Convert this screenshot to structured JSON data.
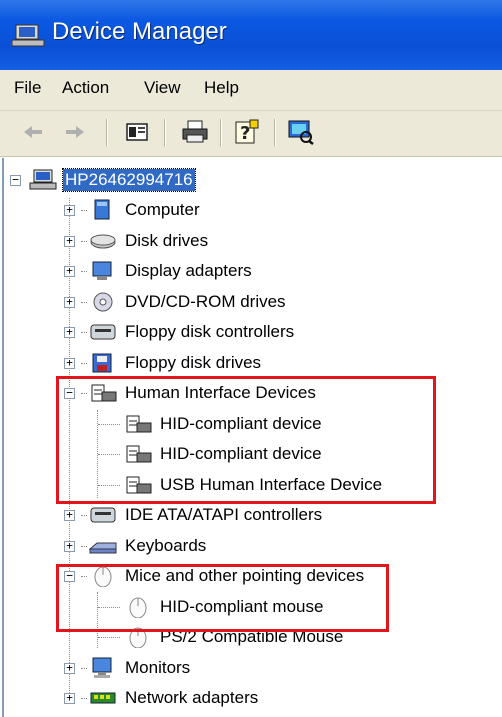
{
  "window": {
    "title": "Device Manager"
  },
  "menu": [
    "File",
    "Action",
    "View",
    "Help"
  ],
  "toolbar": [
    "back-icon",
    "forward-icon",
    "properties-view-icon",
    "print-icon",
    "help-icon",
    "scan-hardware-icon"
  ],
  "tree": {
    "root": "HP26462994716",
    "categories": [
      {
        "label": "Computer",
        "expanded": false,
        "icon": "computer-icon"
      },
      {
        "label": "Disk drives",
        "expanded": false,
        "icon": "disk-drive-icon"
      },
      {
        "label": "Display adapters",
        "expanded": false,
        "icon": "display-adapter-icon"
      },
      {
        "label": "DVD/CD-ROM drives",
        "expanded": false,
        "icon": "cdrom-icon"
      },
      {
        "label": "Floppy disk controllers",
        "expanded": false,
        "icon": "floppy-controller-icon"
      },
      {
        "label": "Floppy disk drives",
        "expanded": false,
        "icon": "floppy-drive-icon"
      },
      {
        "label": "Human Interface Devices",
        "expanded": true,
        "icon": "hid-icon",
        "children": [
          "HID-compliant device",
          "HID-compliant device",
          "USB Human Interface Device"
        ]
      },
      {
        "label": "IDE ATA/ATAPI controllers",
        "expanded": false,
        "icon": "ide-controller-icon"
      },
      {
        "label": "Keyboards",
        "expanded": false,
        "icon": "keyboard-icon"
      },
      {
        "label": "Mice and other pointing devices",
        "expanded": true,
        "icon": "mouse-icon",
        "children": [
          "HID-compliant mouse",
          "PS/2 Compatible Mouse"
        ]
      },
      {
        "label": "Monitors",
        "expanded": false,
        "icon": "monitor-icon"
      },
      {
        "label": "Network adapters",
        "expanded": false,
        "icon": "network-adapter-icon"
      }
    ]
  },
  "colors": {
    "highlight_box": "#e2141c",
    "selection": "#316ac5",
    "titlebar": "#0b50d6"
  }
}
